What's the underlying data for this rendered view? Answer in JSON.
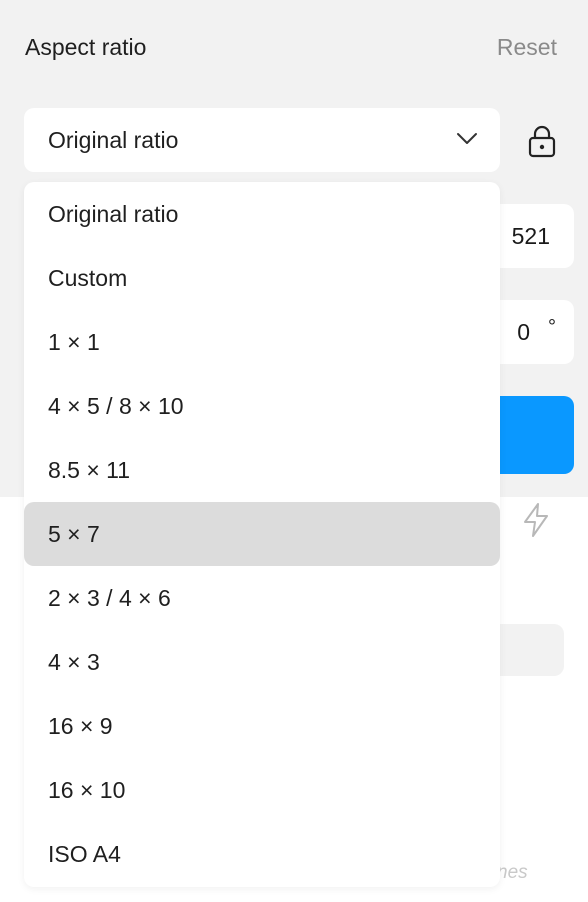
{
  "header": {
    "title": "Aspect ratio",
    "reset_label": "Reset"
  },
  "select": {
    "value": "Original ratio"
  },
  "fields": {
    "width_value": "521",
    "rotation_value": "0",
    "rotation_unit": "°"
  },
  "hint": {
    "text": "nes"
  },
  "dropdown": {
    "selected_index": 5,
    "options": [
      "Original ratio",
      "Custom",
      "1 × 1",
      "4 × 5 / 8 × 10",
      "8.5 × 11",
      "5 × 7",
      "2 × 3 / 4 × 6",
      "4 × 3",
      "16 × 9",
      "16 × 10",
      "ISO A4"
    ]
  },
  "icons": {
    "lock": "lock-icon",
    "chevron": "chevron-down-icon",
    "bolt": "lightning-icon"
  },
  "colors": {
    "accent": "#0a98ff",
    "selected_bg": "#dcdcdc",
    "panel_bg": "#f2f2f2"
  }
}
